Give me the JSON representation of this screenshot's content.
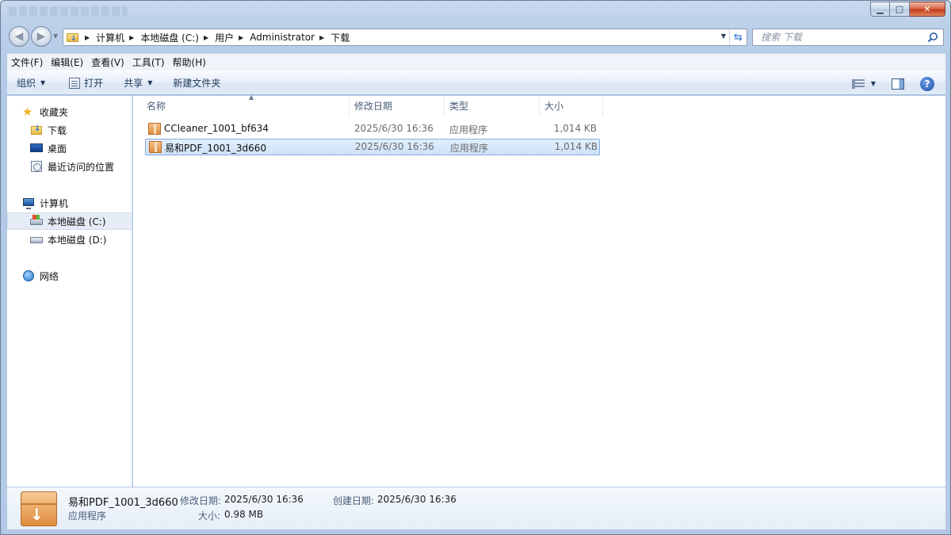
{
  "window": {
    "controls": {
      "minimize": "▁",
      "maximize": "□",
      "close": "✕"
    }
  },
  "nav": {
    "back": "◀",
    "forward": "▶",
    "breadcrumb": [
      "计算机",
      "本地磁盘 (C:)",
      "用户",
      "Administrator",
      "下载"
    ]
  },
  "search": {
    "placeholder": "搜索 下载"
  },
  "menu": [
    "文件(F)",
    "编辑(E)",
    "查看(V)",
    "工具(T)",
    "帮助(H)"
  ],
  "toolbar": {
    "organize": "组织",
    "open": "打开",
    "share": "共享",
    "new_folder": "新建文件夹",
    "help": "?"
  },
  "sidebar": {
    "favorites": {
      "label": "收藏夹",
      "items": [
        "下载",
        "桌面",
        "最近访问的位置"
      ]
    },
    "computer": {
      "label": "计算机",
      "items": [
        "本地磁盘 (C:)",
        "本地磁盘 (D:)"
      ]
    },
    "network": {
      "label": "网络"
    }
  },
  "columns": {
    "name": "名称",
    "date": "修改日期",
    "type": "类型",
    "size": "大小"
  },
  "files": [
    {
      "name": "CCleaner_1001_bf634",
      "date": "2025/6/30 16:36",
      "type": "应用程序",
      "size": "1,014 KB",
      "selected": false
    },
    {
      "name": "易和PDF_1001_3d660",
      "date": "2025/6/30 16:36",
      "type": "应用程序",
      "size": "1,014 KB",
      "selected": true
    }
  ],
  "details": {
    "name": "易和PDF_1001_3d660",
    "type": "应用程序",
    "modified_label": "修改日期:",
    "modified": "2025/6/30 16:36",
    "size_label": "大小:",
    "size": "0.98 MB",
    "created_label": "创建日期:",
    "created": "2025/6/30 16:36"
  },
  "colors": {
    "selection": "#cfe2f9",
    "selection_border": "#84acdd",
    "window_chrome": "#bcd0ea"
  }
}
